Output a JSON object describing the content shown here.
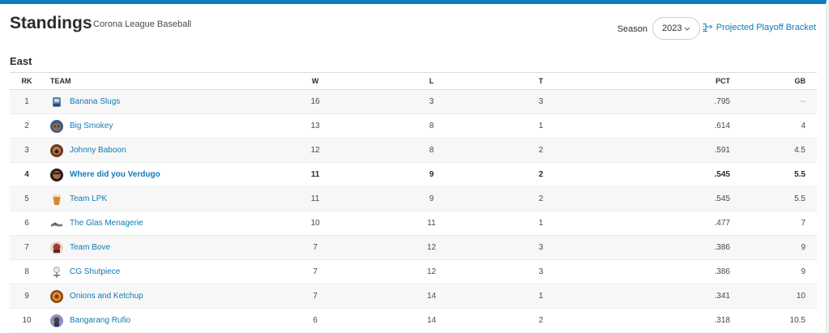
{
  "header": {
    "title": "Standings",
    "subtitle": "Corona League Baseball",
    "season_label": "Season",
    "season_value": "2023",
    "bracket_link": "Projected Playoff Bracket"
  },
  "division": "East",
  "columns": {
    "rk": "RK",
    "team": "TEAM",
    "w": "W",
    "l": "L",
    "t": "T",
    "pct": "PCT",
    "gb": "GB"
  },
  "colors": {
    "accent": "#0f7ab8",
    "row_alt": "#f7f7f7"
  },
  "rows": [
    {
      "rk": "1",
      "team": "Banana Slugs",
      "w": "16",
      "l": "3",
      "t": "3",
      "pct": ".795",
      "gb": "--",
      "icon": "banana-slugs-logo-icon"
    },
    {
      "rk": "2",
      "team": "Big Smokey",
      "w": "13",
      "l": "8",
      "t": "1",
      "pct": ".614",
      "gb": "4",
      "icon": "big-smokey-logo-icon"
    },
    {
      "rk": "3",
      "team": "Johnny Baboon",
      "w": "12",
      "l": "8",
      "t": "2",
      "pct": ".591",
      "gb": "4.5",
      "icon": "johnny-baboon-logo-icon"
    },
    {
      "rk": "4",
      "team": "Where did you Verdugo",
      "w": "11",
      "l": "9",
      "t": "2",
      "pct": ".545",
      "gb": "5.5",
      "icon": "verdugo-logo-icon",
      "highlight": true
    },
    {
      "rk": "5",
      "team": "Team LPK",
      "w": "11",
      "l": "9",
      "t": "2",
      "pct": ".545",
      "gb": "5.5",
      "icon": "team-lpk-logo-icon"
    },
    {
      "rk": "6",
      "team": "The Glas Menagerie",
      "w": "10",
      "l": "11",
      "t": "1",
      "pct": ".477",
      "gb": "7",
      "icon": "glas-menagerie-logo-icon"
    },
    {
      "rk": "7",
      "team": "Team Bove",
      "w": "7",
      "l": "12",
      "t": "3",
      "pct": ".386",
      "gb": "9",
      "icon": "team-bove-logo-icon"
    },
    {
      "rk": "8",
      "team": "CG Shutpiece",
      "w": "7",
      "l": "12",
      "t": "3",
      "pct": ".386",
      "gb": "9",
      "icon": "cg-shutpiece-logo-icon"
    },
    {
      "rk": "9",
      "team": "Onions and Ketchup",
      "w": "7",
      "l": "14",
      "t": "1",
      "pct": ".341",
      "gb": "10",
      "icon": "onions-ketchup-logo-icon"
    },
    {
      "rk": "10",
      "team": "Bangarang Rufio",
      "w": "6",
      "l": "14",
      "t": "2",
      "pct": ".318",
      "gb": "10.5",
      "icon": "bangarang-rufio-logo-icon"
    }
  ]
}
